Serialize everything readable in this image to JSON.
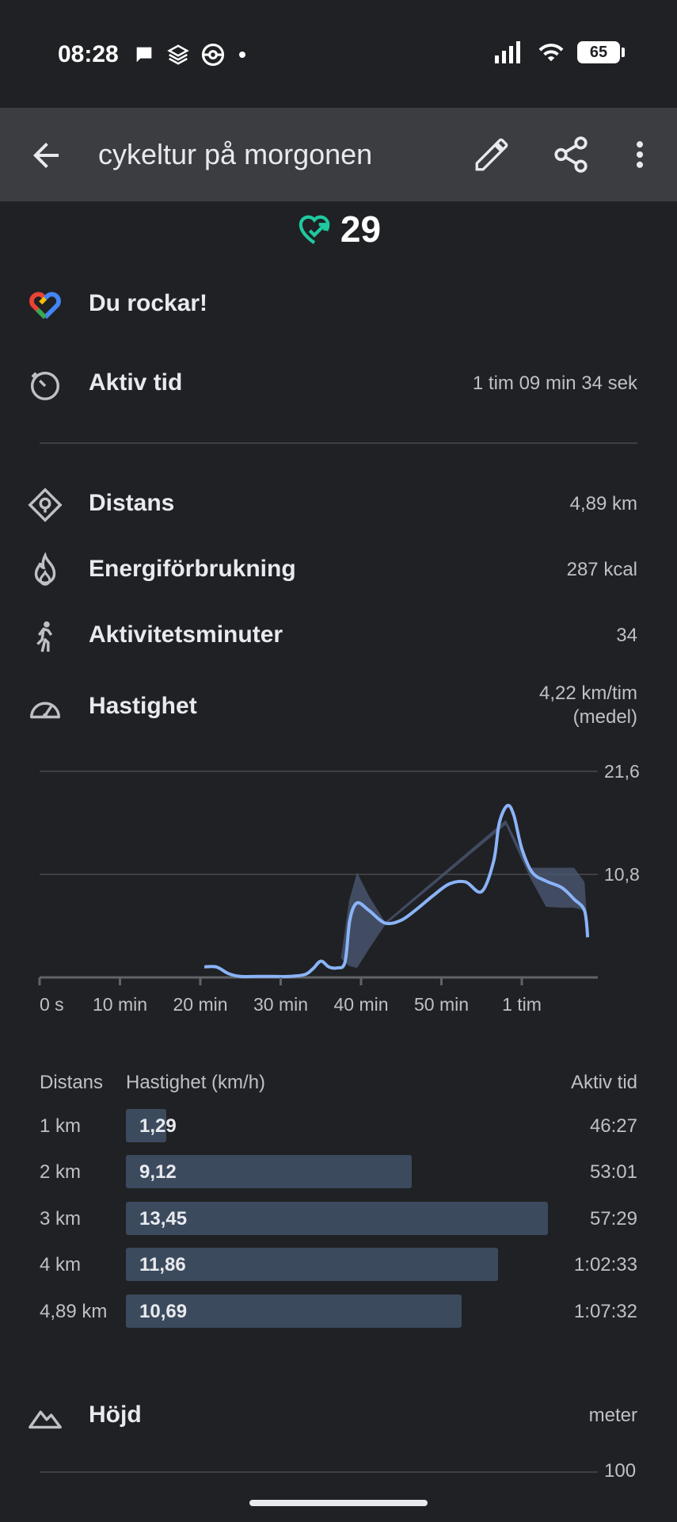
{
  "status_bar": {
    "time": "08:28",
    "battery": "65"
  },
  "app_bar": {
    "title": "cykeltur på morgonen"
  },
  "heart_points": {
    "value": "29"
  },
  "summary": {
    "praise": "Du rockar!",
    "active_time": {
      "label": "Aktiv tid",
      "value": "1 tim 09 min 34 sek"
    }
  },
  "stats": {
    "distance": {
      "label": "Distans",
      "value": "4,89 km"
    },
    "energy": {
      "label": "Energiförbrukning",
      "value": "287 kcal"
    },
    "active_minutes": {
      "label": "Aktivitetsminuter",
      "value": "34"
    },
    "speed": {
      "label": "Hastighet",
      "value_line1": "4,22 km/tim",
      "value_line2": "(medel)"
    }
  },
  "chart_data": {
    "type": "line",
    "x_ticks": [
      "0 s",
      "10 min",
      "20 min",
      "30 min",
      "40 min",
      "50 min",
      "1 tim"
    ],
    "y_ticks": [
      "21,6",
      "10,8"
    ],
    "ylim": [
      0,
      21.6
    ],
    "xlim_minutes": [
      0,
      69.5
    ],
    "series": [
      {
        "x_minutes": [
          20.5,
          22,
          23.5,
          25,
          27,
          29,
          31,
          33,
          34,
          35,
          36,
          37,
          38,
          38.6,
          39.5,
          41,
          43,
          45,
          47,
          49,
          51,
          53,
          55,
          56.5,
          57.2,
          58.2,
          59,
          60,
          61.3,
          63,
          65,
          66.5,
          67.8,
          68.2
        ],
        "values": [
          1.1,
          1.1,
          0.4,
          0.1,
          0.1,
          0.1,
          0.1,
          0.3,
          0.9,
          1.7,
          1.1,
          1.0,
          1.6,
          6.0,
          7.8,
          7.0,
          5.7,
          6.0,
          7.2,
          8.6,
          9.8,
          10.0,
          9.0,
          12.2,
          16.2,
          18.0,
          17.0,
          13.5,
          11.0,
          10.1,
          9.4,
          8.2,
          7.0,
          4.2
        ]
      }
    ],
    "band": {
      "upper": [
        [
          37.5,
          2.0
        ],
        [
          38.5,
          8.0
        ],
        [
          39.5,
          11.0
        ],
        [
          41,
          8.5
        ],
        [
          43,
          5.8
        ],
        [
          58,
          16.5
        ],
        [
          61,
          11.5
        ],
        [
          63,
          11.5
        ],
        [
          66.5,
          11.5
        ],
        [
          67.8,
          10.0
        ],
        [
          68.2,
          5.0
        ]
      ],
      "lower": [
        [
          68.2,
          5.0
        ],
        [
          67.8,
          7.0
        ],
        [
          66.5,
          7.3
        ],
        [
          65,
          7.3
        ],
        [
          63,
          7.4
        ],
        [
          61,
          10.5
        ],
        [
          58,
          16.0
        ],
        [
          43,
          5.5
        ],
        [
          41,
          3.0
        ],
        [
          39.5,
          1.0
        ],
        [
          38.5,
          1.2
        ],
        [
          37.5,
          2.0
        ]
      ]
    }
  },
  "splits": {
    "headers": {
      "distance": "Distans",
      "speed": "Hastighet (km/h)",
      "time": "Aktiv tid"
    },
    "max_speed": 13.45,
    "rows": [
      {
        "distance": "1 km",
        "speed_label": "1,29",
        "speed": 1.29,
        "time": "46:27"
      },
      {
        "distance": "2 km",
        "speed_label": "9,12",
        "speed": 9.12,
        "time": "53:01"
      },
      {
        "distance": "3 km",
        "speed_label": "13,45",
        "speed": 13.45,
        "time": "57:29"
      },
      {
        "distance": "4 km",
        "speed_label": "11,86",
        "speed": 11.86,
        "time": "1:02:33"
      },
      {
        "distance": "4,89 km",
        "speed_label": "10,69",
        "speed": 10.69,
        "time": "1:07:32"
      }
    ]
  },
  "elevation": {
    "label": "Höjd",
    "unit": "meter",
    "tick": "100"
  }
}
